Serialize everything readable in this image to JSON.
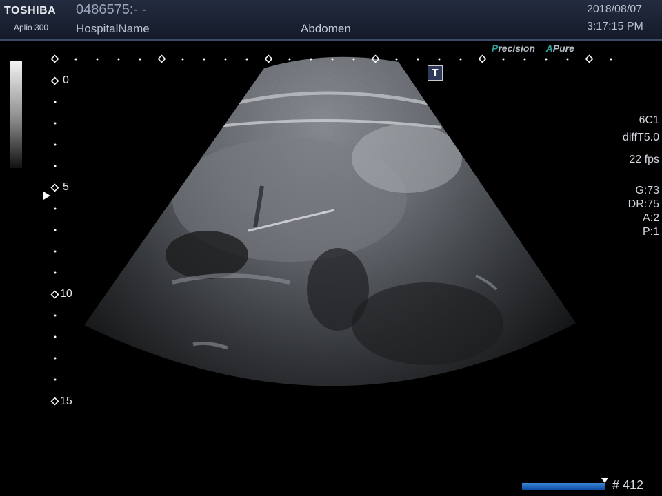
{
  "header": {
    "brand": "TOSHIBA",
    "model": "Aplio 300",
    "patient_id": "0486575:- -",
    "hospital": "HospitalName",
    "preset": "Abdomen",
    "date": "2018/08/07",
    "time": "3:17:15 PM"
  },
  "logos": {
    "precision_p": "P",
    "precision_rest": "recision",
    "apure_a": "A",
    "apure_rest": "Pure"
  },
  "t_marker": "T",
  "params": {
    "probe": "6C1",
    "freq": "diffT5.0",
    "fps": "22 fps",
    "gain": "G:73",
    "dynamic_range": "DR:75",
    "a": "A:2",
    "p": "P:1"
  },
  "depth_labels": {
    "d0": "0",
    "d5": "5",
    "d10": "10",
    "d15": "15"
  },
  "frame": "# 412",
  "colors": {
    "header_bg": "#1b2233",
    "accent": "#2aa39a",
    "cine_bar": "#2f7fd2"
  }
}
